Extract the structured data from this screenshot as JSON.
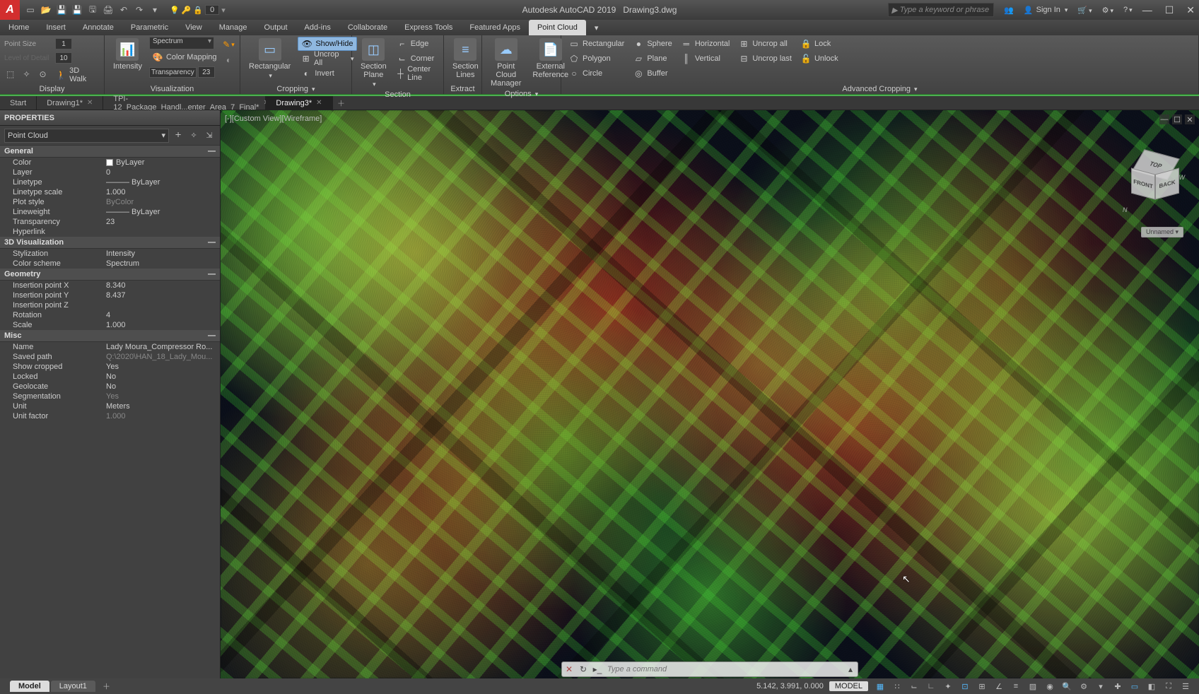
{
  "app": {
    "logo": "A",
    "name": "Autodesk AutoCAD 2019",
    "doc": "Drawing3.dwg",
    "search_placeholder": "Type a keyword or phrase",
    "signin": "Sign In"
  },
  "qat": {
    "workspace_number": "0"
  },
  "menu": [
    "Home",
    "Insert",
    "Annotate",
    "Parametric",
    "View",
    "Manage",
    "Output",
    "Add-ins",
    "Collaborate",
    "Express Tools",
    "Featured Apps",
    "Point Cloud"
  ],
  "menu_active": 11,
  "ribbon": {
    "display": {
      "label": "Display",
      "point_size_lbl": "Point Size",
      "point_size_val": "1",
      "lod_lbl": "Level of Detail",
      "lod_val": "10",
      "walk": "3D Walk"
    },
    "viz": {
      "label": "Visualization",
      "intensity": "Intensity",
      "spectrum": "Spectrum",
      "color_mapping": "Color Mapping",
      "transparency_lbl": "Transparency",
      "transparency_val": "23"
    },
    "cropping": {
      "label": "Cropping",
      "rectangular": "Rectangular",
      "showhide": "Show/Hide",
      "uncrop_all": "Uncrop All",
      "invert": "Invert"
    },
    "section": {
      "label": "Section",
      "plane": "Section\nPlane",
      "lines": "Section\nLines",
      "edge": "Edge",
      "corner": "Corner",
      "center": "Center Line"
    },
    "extract": {
      "label": "Extract"
    },
    "options": {
      "label": "Options",
      "manager": "Point Cloud\nManager",
      "extref": "External\nReference"
    },
    "advcrop": {
      "label": "Advanced Cropping",
      "rectangular": "Rectangular",
      "polygon": "Polygon",
      "circle": "Circle",
      "sphere": "Sphere",
      "plane": "Plane",
      "buffer": "Buffer",
      "horizontal": "Horizontal",
      "vertical": "Vertical",
      "uncrop_all": "Uncrop all",
      "uncrop_last": "Uncrop last",
      "lock": "Lock",
      "unlock": "Unlock"
    }
  },
  "file_tabs": [
    {
      "label": "Start",
      "close": false
    },
    {
      "label": "Drawing1*",
      "close": true
    },
    {
      "label": "TPI-12_Package_Handl...enter_Area_7_Final*",
      "close": true
    },
    {
      "label": "Drawing3*",
      "close": true,
      "active": true
    }
  ],
  "properties": {
    "title": "PROPERTIES",
    "type": "Point Cloud",
    "sections": [
      {
        "name": "General",
        "rows": [
          {
            "k": "Color",
            "v": "ByLayer",
            "swatch": true
          },
          {
            "k": "Layer",
            "v": "0"
          },
          {
            "k": "Linetype",
            "v": "——— ByLayer"
          },
          {
            "k": "Linetype scale",
            "v": "1.000"
          },
          {
            "k": "Plot style",
            "v": "ByColor",
            "dim": true
          },
          {
            "k": "Lineweight",
            "v": "——— ByLayer"
          },
          {
            "k": "Transparency",
            "v": "23"
          },
          {
            "k": "Hyperlink",
            "v": ""
          }
        ]
      },
      {
        "name": "3D Visualization",
        "rows": [
          {
            "k": "Stylization",
            "v": "Intensity"
          },
          {
            "k": "Color scheme",
            "v": "Spectrum"
          }
        ]
      },
      {
        "name": "Geometry",
        "rows": [
          {
            "k": "Insertion point X",
            "v": "8.340"
          },
          {
            "k": "Insertion point Y",
            "v": "8.437"
          },
          {
            "k": "Insertion point Z",
            "v": ""
          },
          {
            "k": "Rotation",
            "v": "4"
          },
          {
            "k": "Scale",
            "v": "1.000"
          }
        ]
      },
      {
        "name": "Misc",
        "rows": [
          {
            "k": "Name",
            "v": "Lady  Moura_Compressor  Ro..."
          },
          {
            "k": "Saved path",
            "v": "Q:\\2020\\HAN_18_Lady_Mou...",
            "dim": true
          },
          {
            "k": "Show cropped",
            "v": "Yes"
          },
          {
            "k": "Locked",
            "v": "No"
          },
          {
            "k": "Geolocate",
            "v": "No"
          },
          {
            "k": "Segmentation",
            "v": "Yes",
            "dim": true
          },
          {
            "k": "Unit",
            "v": "Meters"
          },
          {
            "k": "Unit factor",
            "v": "1.000",
            "dim": true
          }
        ]
      }
    ]
  },
  "viewport": {
    "label": "[-][Custom View][Wireframe]",
    "cube": {
      "top": "TOP",
      "front": "FRONT",
      "side": "BACK"
    },
    "badge": "Unnamed",
    "compass": {
      "n": "N",
      "w": "W"
    }
  },
  "cmdline": {
    "placeholder": "Type a command"
  },
  "layout_tabs": {
    "model": "Model",
    "layout1": "Layout1"
  },
  "status": {
    "coords": "5.142, 3.991, 0.000",
    "model": "MODEL"
  }
}
